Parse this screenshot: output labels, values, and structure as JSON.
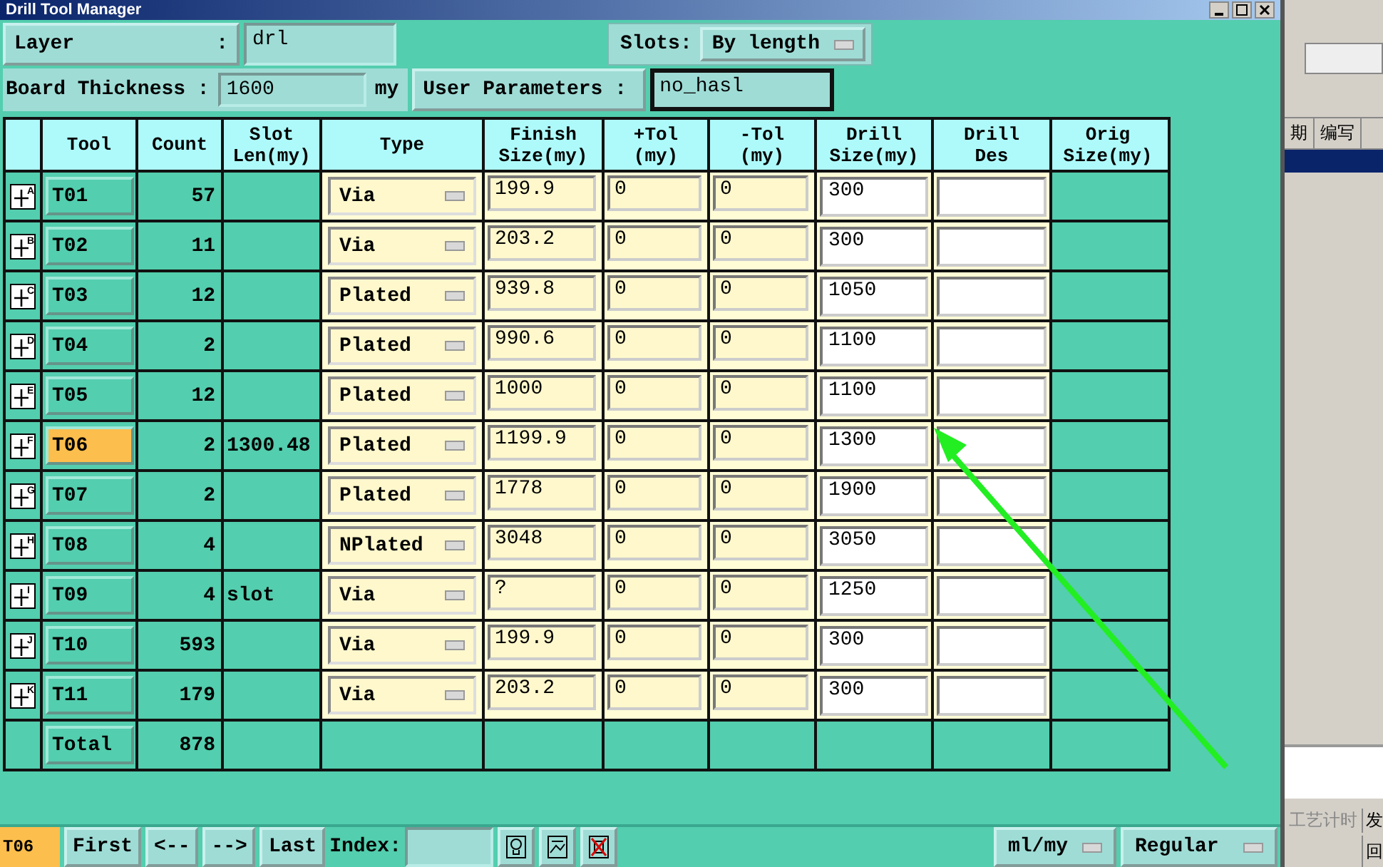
{
  "window": {
    "title": "Drill Tool Manager"
  },
  "header": {
    "layer_label": "Layer",
    "layer_colon": ":",
    "layer_value": "drl",
    "slots_label": "Slots:",
    "slots_value": "By length",
    "thickness_label": "Board Thickness :",
    "thickness_value": "1600",
    "thickness_unit": "my",
    "user_params_label": "User Parameters :",
    "user_params_value": "no_hasl"
  },
  "table": {
    "columns": [
      "Tool",
      "Count",
      "Slot Len(my)",
      "Type",
      "Finish Size(my)",
      "+Tol (my)",
      "-Tol (my)",
      "Drill Size(my)",
      "Drill Des",
      "Orig Size(my)"
    ],
    "rows": [
      {
        "symbol": "A",
        "tool": "T01",
        "count": "57",
        "type": "Via",
        "finish": "199.9",
        "plus_tol": "0",
        "minus_tol": "0",
        "drill_size": "300",
        "selected": false
      },
      {
        "symbol": "B",
        "tool": "T02",
        "count": "11",
        "type": "Via",
        "finish": "203.2",
        "plus_tol": "0",
        "minus_tol": "0",
        "drill_size": "300",
        "selected": false
      },
      {
        "symbol": "C",
        "tool": "T03",
        "count": "12",
        "type": "Plated",
        "finish": "939.8",
        "plus_tol": "0",
        "minus_tol": "0",
        "drill_size": "1050",
        "selected": false
      },
      {
        "symbol": "D",
        "tool": "T04",
        "count": "2",
        "type": "Plated",
        "finish": "990.6",
        "plus_tol": "0",
        "minus_tol": "0",
        "drill_size": "1100",
        "selected": false
      },
      {
        "symbol": "E",
        "tool": "T05",
        "count": "12",
        "type": "Plated",
        "finish": "1000",
        "plus_tol": "0",
        "minus_tol": "0",
        "drill_size": "1100",
        "selected": false
      },
      {
        "symbol": "F",
        "tool": "T06",
        "count": "2",
        "slot_len": "1300.48",
        "type": "Plated",
        "finish": "1199.9",
        "plus_tol": "0",
        "minus_tol": "0",
        "drill_size": "1300",
        "selected": true
      },
      {
        "symbol": "G",
        "tool": "T07",
        "count": "2",
        "type": "Plated",
        "finish": "1778",
        "plus_tol": "0",
        "minus_tol": "0",
        "drill_size": "1900",
        "selected": false
      },
      {
        "symbol": "H",
        "tool": "T08",
        "count": "4",
        "type": "NPlated",
        "finish": "3048",
        "plus_tol": "0",
        "minus_tol": "0",
        "drill_size": "3050",
        "selected": false
      },
      {
        "symbol": "I",
        "tool": "T09",
        "count": "4",
        "slot_len": "slot",
        "type": "Via",
        "finish": "?",
        "plus_tol": "0",
        "minus_tol": "0",
        "drill_size": "1250",
        "selected": false
      },
      {
        "symbol": "J",
        "tool": "T10",
        "count": "593",
        "type": "Via",
        "finish": "199.9",
        "plus_tol": "0",
        "minus_tol": "0",
        "drill_size": "300",
        "selected": false
      },
      {
        "symbol": "K",
        "tool": "T11",
        "count": "179",
        "type": "Via",
        "finish": "203.2",
        "plus_tol": "0",
        "minus_tol": "0",
        "drill_size": "300",
        "selected": false
      }
    ],
    "total": {
      "label": "Total",
      "count": "878"
    }
  },
  "bottom_bar": {
    "current_tool": "T06",
    "buttons": [
      "First",
      "<--",
      "-->",
      "Last"
    ],
    "index_label": "Index:",
    "units": "ml/my",
    "mode": "Regular"
  },
  "background_app": {
    "headers": [
      "期",
      "编写"
    ],
    "tab": "工艺计时",
    "side_texts": [
      "发",
      "回"
    ]
  }
}
